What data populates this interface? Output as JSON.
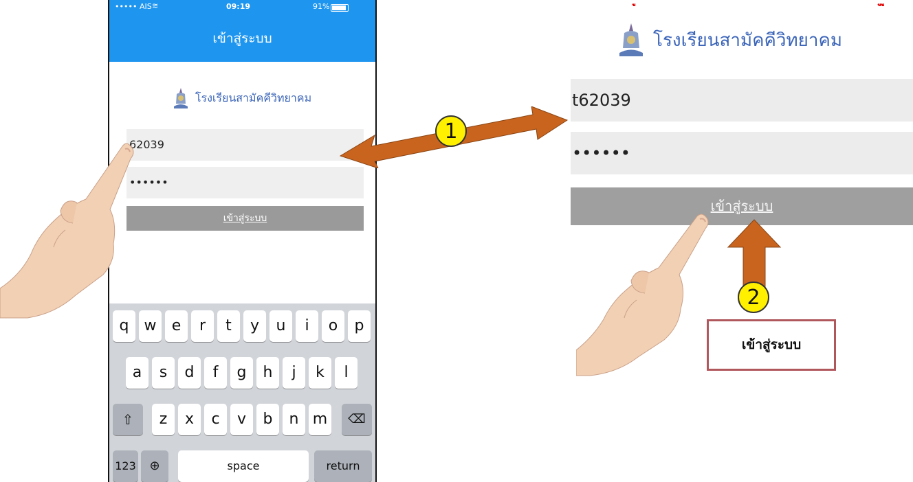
{
  "phone": {
    "status_bar": {
      "carrier": "••••• AIS ",
      "time": "09:19",
      "battery_percent": "91%"
    },
    "nav_title": "เข้าสู่ระบบ",
    "school_name": "โรงเรียนสามัคคีวิทยาคม",
    "username_value": "62039",
    "password_value": "••••••",
    "login_label": "เข้าสู่ระบบ",
    "keyboard": {
      "row1": [
        "q",
        "w",
        "e",
        "r",
        "t",
        "y",
        "u",
        "i",
        "o",
        "p"
      ],
      "row2": [
        "a",
        "s",
        "d",
        "f",
        "g",
        "h",
        "j",
        "k",
        "l"
      ],
      "row3": [
        "z",
        "x",
        "c",
        "v",
        "b",
        "n",
        "m"
      ],
      "numbers_label": "123",
      "space_label": "space",
      "return_label": "return"
    }
  },
  "zoom": {
    "school_name": "โรงเรียนสามัคคีวิทยาคม",
    "username_value": "t62039",
    "password_value": "••••••",
    "login_label": "เข้าสู่ระบบ"
  },
  "annotations": {
    "step1": "1",
    "step2": "2",
    "callout_label": "เข้าสู่ระบบ"
  },
  "colors": {
    "nav_blue": "#1e96f0",
    "arrow_orange": "#c8641e",
    "badge_yellow": "#fff000",
    "callout_border": "#b0575c",
    "school_blue": "#3a64b8"
  }
}
